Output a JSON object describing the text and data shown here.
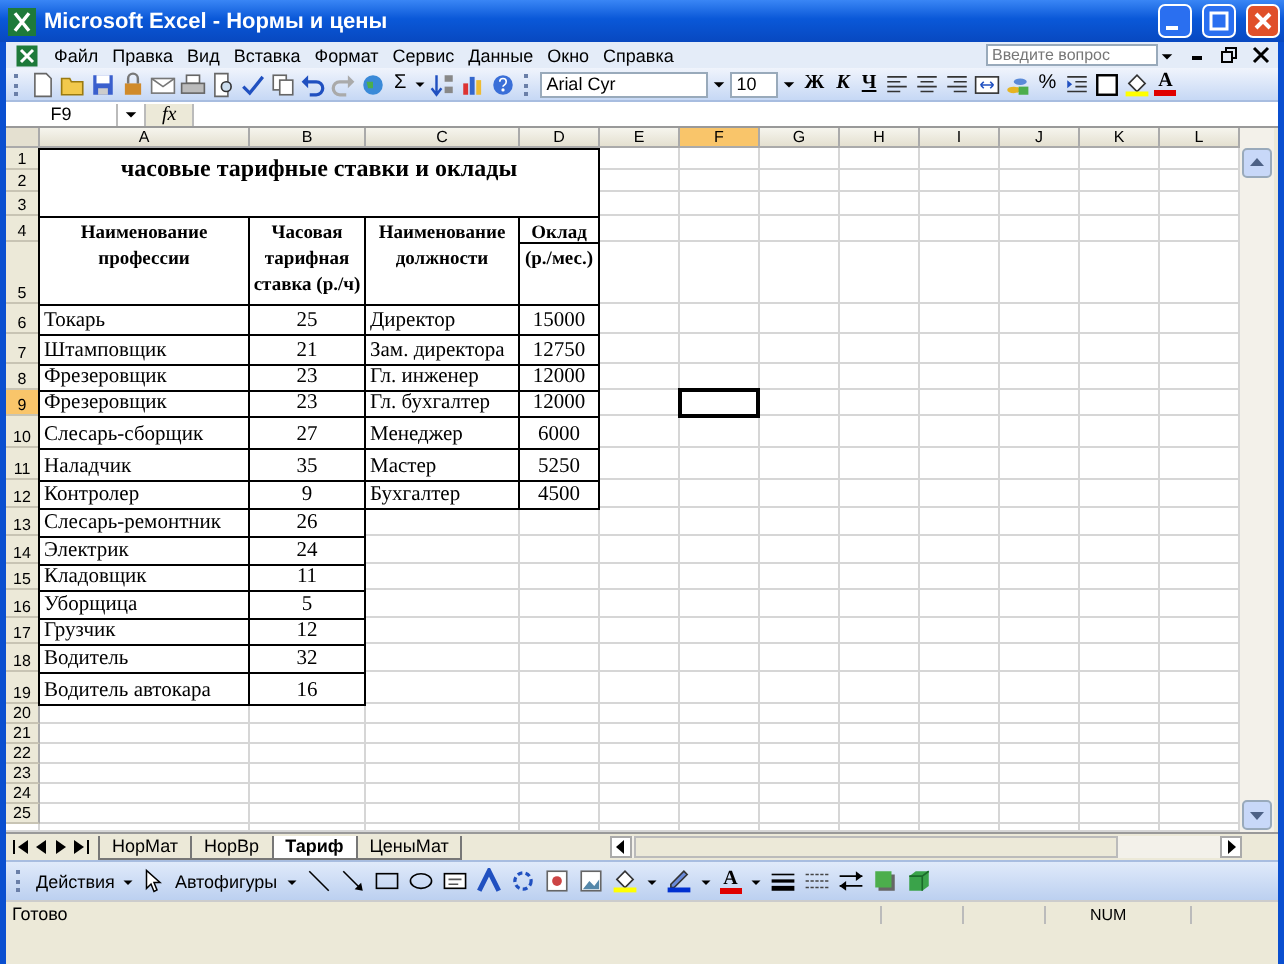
{
  "window": {
    "title": "Microsoft Excel - Нормы и цены"
  },
  "menu": [
    "Файл",
    "Правка",
    "Вид",
    "Вставка",
    "Формат",
    "Сервис",
    "Данные",
    "Окно",
    "Справка"
  ],
  "help_search": {
    "placeholder": "Введите вопрос"
  },
  "standard_toolbar": {
    "autosum_label": "Σ"
  },
  "formatting_toolbar": {
    "font": "Arial Cyr",
    "size": "10",
    "bold_label": "Ж",
    "italic_label": "К",
    "underline_label": "Ч",
    "percent_label": "%",
    "font_color_label": "A"
  },
  "formula_bar": {
    "name_box": "F9",
    "function_label": "fx"
  },
  "columns": [
    {
      "label": "A",
      "selected": false
    },
    {
      "label": "B",
      "selected": false
    },
    {
      "label": "C",
      "selected": false
    },
    {
      "label": "D",
      "selected": false
    },
    {
      "label": "E",
      "selected": false
    },
    {
      "label": "F",
      "selected": true
    },
    {
      "label": "G",
      "selected": false
    },
    {
      "label": "H",
      "selected": false
    },
    {
      "label": "I",
      "selected": false
    },
    {
      "label": "J",
      "selected": false
    },
    {
      "label": "K",
      "selected": false
    },
    {
      "label": "L",
      "selected": false
    }
  ],
  "row_numbers": [
    {
      "label": "1",
      "selected": false
    },
    {
      "label": "2",
      "selected": false
    },
    {
      "label": "3",
      "selected": false
    },
    {
      "label": "4",
      "selected": false
    },
    {
      "label": "5",
      "selected": false
    },
    {
      "label": "6",
      "selected": false
    },
    {
      "label": "7",
      "selected": false
    },
    {
      "label": "8",
      "selected": false
    },
    {
      "label": "9",
      "selected": true
    },
    {
      "label": "10",
      "selected": false
    },
    {
      "label": "11",
      "selected": false
    },
    {
      "label": "12",
      "selected": false
    },
    {
      "label": "13",
      "selected": false
    },
    {
      "label": "14",
      "selected": false
    },
    {
      "label": "15",
      "selected": false
    },
    {
      "label": "16",
      "selected": false
    },
    {
      "label": "17",
      "selected": false
    },
    {
      "label": "18",
      "selected": false
    },
    {
      "label": "19",
      "selected": false
    },
    {
      "label": "20",
      "selected": false
    },
    {
      "label": "21",
      "selected": false
    },
    {
      "label": "22",
      "selected": false
    },
    {
      "label": "23",
      "selected": false
    },
    {
      "label": "24",
      "selected": false
    },
    {
      "label": "25",
      "selected": false
    }
  ],
  "sheet": {
    "title": "часовые тарифные ставки и оклады",
    "headers": {
      "profession": "Наименование профессии",
      "rate": "Часовая тарифная ставка (р./ч)",
      "position": "Наименование должности",
      "salary": "Оклад",
      "salary_unit": "(р./мес.)"
    },
    "rows": [
      {
        "profession": "Токарь",
        "rate": "25",
        "position": "Директор",
        "salary": "15000"
      },
      {
        "profession": "Штамповщик",
        "rate": "21",
        "position": "Зам. директора",
        "salary": "12750"
      },
      {
        "profession": "Фрезеровщик",
        "rate": "23",
        "position": "Гл. инженер",
        "salary": "12000"
      },
      {
        "profession": "Фрезеровщик",
        "rate": "23",
        "position": "Гл. бухгалтер",
        "salary": "12000"
      },
      {
        "profession": "Слесарь-сборщик",
        "rate": "27",
        "position": "Менеджер",
        "salary": "6000"
      },
      {
        "profession": "Наладчик",
        "rate": "35",
        "position": "Мастер",
        "salary": "5250"
      },
      {
        "profession": "Контролер",
        "rate": "9",
        "position": "Бухгалтер",
        "salary": "4500"
      },
      {
        "profession": "Слесарь-ремонтник",
        "rate": "26"
      },
      {
        "profession": "Электрик",
        "rate": "24"
      },
      {
        "profession": "Кладовщик",
        "rate": "11"
      },
      {
        "profession": "Уборщица",
        "rate": "5"
      },
      {
        "profession": "Грузчик",
        "rate": "12"
      },
      {
        "profession": "Водитель",
        "rate": "32"
      },
      {
        "profession": "Водитель автокара",
        "rate": "16"
      }
    ]
  },
  "sheet_tabs": [
    {
      "label": "НорМат",
      "selected": false
    },
    {
      "label": "НорВр",
      "selected": false
    },
    {
      "label": "Тариф",
      "selected": true
    },
    {
      "label": "ЦеныМат",
      "selected": false
    }
  ],
  "drawing_toolbar": {
    "actions": "Действия",
    "autoshapes": "Автофигуры",
    "font_color_label": "A"
  },
  "status_bar": {
    "text": "Готово",
    "num": "NUM"
  }
}
